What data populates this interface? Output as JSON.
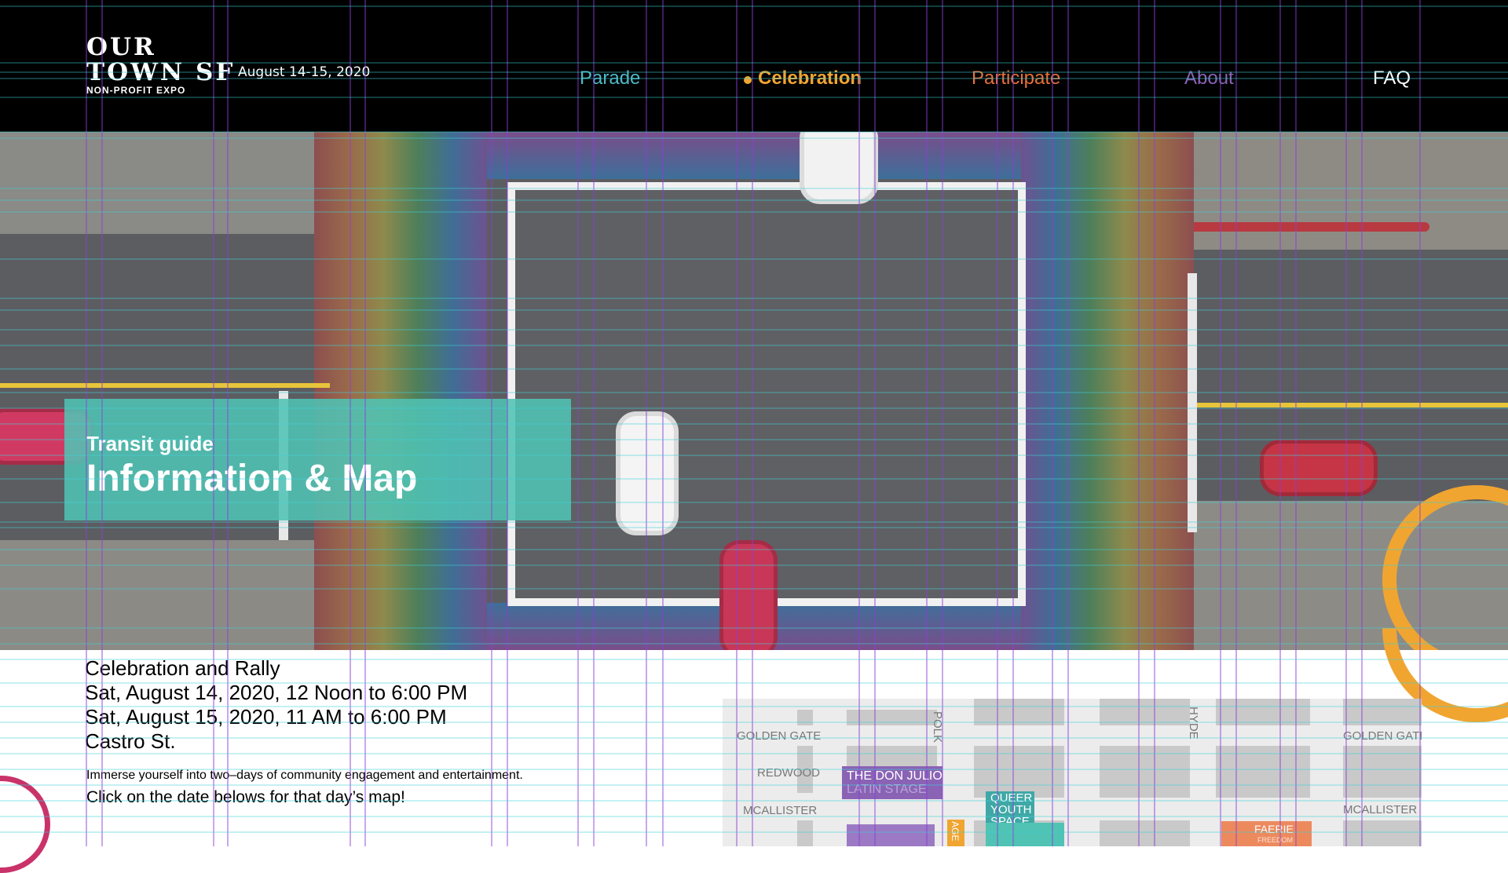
{
  "header": {
    "logo": {
      "line1": "OUR",
      "line2": "TOWN SF",
      "subtitle": "NON-PROFIT EXPO"
    },
    "date": "August 14-15, 2020",
    "nav": [
      {
        "label": "Parade",
        "color": "#4fb8c8",
        "active": false
      },
      {
        "label": "Celebration",
        "color": "#f0a531",
        "active": true
      },
      {
        "label": "Participate",
        "color": "#e8703a",
        "active": false
      },
      {
        "label": "About",
        "color": "#8a63b5",
        "active": false
      },
      {
        "label": "FAQ",
        "color": "#ffffff",
        "active": false
      }
    ]
  },
  "hero": {
    "kicker": "Transit guide",
    "title": "Information & Map",
    "overlay_color": "#50c3b4"
  },
  "info": {
    "event": "Celebration and Rally",
    "dates": [
      "Sat, August 14, 2020, 12 Noon to 6:00 PM",
      "Sat, August 15, 2020, 11 AM to 6:00 PM"
    ],
    "location": "Castro St.",
    "description": "Immerse yourself into two–days of community engagement and entertainment.",
    "cta": "Click on the date belows for that day’s map!"
  },
  "map": {
    "streets": {
      "golden_gate_left": "GOLDEN GATE",
      "redwood": "REDWOOD",
      "mcallister_left": "MCALLISTER",
      "polk": "POLK",
      "hyde": "HYDE",
      "golden_gate_right": "GOLDEN GATE",
      "mcallister_right": "MCALLISTER"
    },
    "stages": {
      "don_julio_1": "THE DON JULIO",
      "don_julio_2": "LATIN STAGE",
      "queer_1": "QUEER",
      "queer_2": "YOUTH",
      "queer_3": "SPACE",
      "faerie": "FAERIE",
      "faerie_sub": "FREEDOM",
      "age": "AGE"
    }
  },
  "colors": {
    "accent_orange": "#f0a531",
    "accent_pink": "#c9336a",
    "teal": "#50c3b4",
    "purple": "#8a63b5"
  }
}
